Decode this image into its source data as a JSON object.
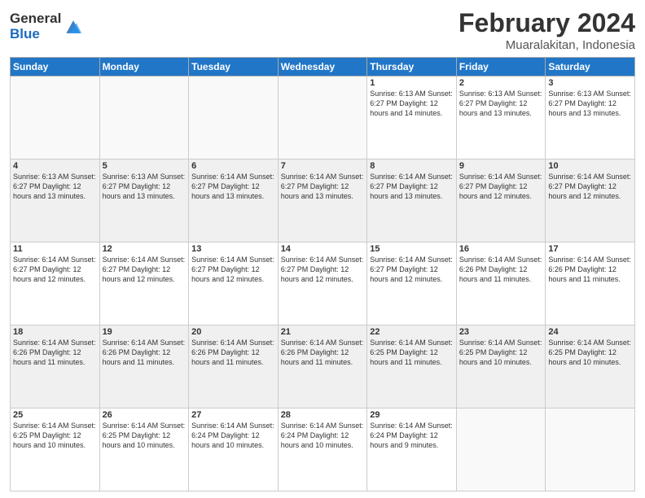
{
  "logo": {
    "general": "General",
    "blue": "Blue"
  },
  "title": {
    "month": "February 2024",
    "location": "Muaralakitan, Indonesia"
  },
  "days_header": [
    "Sunday",
    "Monday",
    "Tuesday",
    "Wednesday",
    "Thursday",
    "Friday",
    "Saturday"
  ],
  "weeks": [
    {
      "shaded": false,
      "days": [
        {
          "num": "",
          "info": ""
        },
        {
          "num": "",
          "info": ""
        },
        {
          "num": "",
          "info": ""
        },
        {
          "num": "",
          "info": ""
        },
        {
          "num": "1",
          "info": "Sunrise: 6:13 AM\nSunset: 6:27 PM\nDaylight: 12 hours\nand 14 minutes."
        },
        {
          "num": "2",
          "info": "Sunrise: 6:13 AM\nSunset: 6:27 PM\nDaylight: 12 hours\nand 13 minutes."
        },
        {
          "num": "3",
          "info": "Sunrise: 6:13 AM\nSunset: 6:27 PM\nDaylight: 12 hours\nand 13 minutes."
        }
      ]
    },
    {
      "shaded": true,
      "days": [
        {
          "num": "4",
          "info": "Sunrise: 6:13 AM\nSunset: 6:27 PM\nDaylight: 12 hours\nand 13 minutes."
        },
        {
          "num": "5",
          "info": "Sunrise: 6:13 AM\nSunset: 6:27 PM\nDaylight: 12 hours\nand 13 minutes."
        },
        {
          "num": "6",
          "info": "Sunrise: 6:14 AM\nSunset: 6:27 PM\nDaylight: 12 hours\nand 13 minutes."
        },
        {
          "num": "7",
          "info": "Sunrise: 6:14 AM\nSunset: 6:27 PM\nDaylight: 12 hours\nand 13 minutes."
        },
        {
          "num": "8",
          "info": "Sunrise: 6:14 AM\nSunset: 6:27 PM\nDaylight: 12 hours\nand 13 minutes."
        },
        {
          "num": "9",
          "info": "Sunrise: 6:14 AM\nSunset: 6:27 PM\nDaylight: 12 hours\nand 12 minutes."
        },
        {
          "num": "10",
          "info": "Sunrise: 6:14 AM\nSunset: 6:27 PM\nDaylight: 12 hours\nand 12 minutes."
        }
      ]
    },
    {
      "shaded": false,
      "days": [
        {
          "num": "11",
          "info": "Sunrise: 6:14 AM\nSunset: 6:27 PM\nDaylight: 12 hours\nand 12 minutes."
        },
        {
          "num": "12",
          "info": "Sunrise: 6:14 AM\nSunset: 6:27 PM\nDaylight: 12 hours\nand 12 minutes."
        },
        {
          "num": "13",
          "info": "Sunrise: 6:14 AM\nSunset: 6:27 PM\nDaylight: 12 hours\nand 12 minutes."
        },
        {
          "num": "14",
          "info": "Sunrise: 6:14 AM\nSunset: 6:27 PM\nDaylight: 12 hours\nand 12 minutes."
        },
        {
          "num": "15",
          "info": "Sunrise: 6:14 AM\nSunset: 6:27 PM\nDaylight: 12 hours\nand 12 minutes."
        },
        {
          "num": "16",
          "info": "Sunrise: 6:14 AM\nSunset: 6:26 PM\nDaylight: 12 hours\nand 11 minutes."
        },
        {
          "num": "17",
          "info": "Sunrise: 6:14 AM\nSunset: 6:26 PM\nDaylight: 12 hours\nand 11 minutes."
        }
      ]
    },
    {
      "shaded": true,
      "days": [
        {
          "num": "18",
          "info": "Sunrise: 6:14 AM\nSunset: 6:26 PM\nDaylight: 12 hours\nand 11 minutes."
        },
        {
          "num": "19",
          "info": "Sunrise: 6:14 AM\nSunset: 6:26 PM\nDaylight: 12 hours\nand 11 minutes."
        },
        {
          "num": "20",
          "info": "Sunrise: 6:14 AM\nSunset: 6:26 PM\nDaylight: 12 hours\nand 11 minutes."
        },
        {
          "num": "21",
          "info": "Sunrise: 6:14 AM\nSunset: 6:26 PM\nDaylight: 12 hours\nand 11 minutes."
        },
        {
          "num": "22",
          "info": "Sunrise: 6:14 AM\nSunset: 6:25 PM\nDaylight: 12 hours\nand 11 minutes."
        },
        {
          "num": "23",
          "info": "Sunrise: 6:14 AM\nSunset: 6:25 PM\nDaylight: 12 hours\nand 10 minutes."
        },
        {
          "num": "24",
          "info": "Sunrise: 6:14 AM\nSunset: 6:25 PM\nDaylight: 12 hours\nand 10 minutes."
        }
      ]
    },
    {
      "shaded": false,
      "days": [
        {
          "num": "25",
          "info": "Sunrise: 6:14 AM\nSunset: 6:25 PM\nDaylight: 12 hours\nand 10 minutes."
        },
        {
          "num": "26",
          "info": "Sunrise: 6:14 AM\nSunset: 6:25 PM\nDaylight: 12 hours\nand 10 minutes."
        },
        {
          "num": "27",
          "info": "Sunrise: 6:14 AM\nSunset: 6:24 PM\nDaylight: 12 hours\nand 10 minutes."
        },
        {
          "num": "28",
          "info": "Sunrise: 6:14 AM\nSunset: 6:24 PM\nDaylight: 12 hours\nand 10 minutes."
        },
        {
          "num": "29",
          "info": "Sunrise: 6:14 AM\nSunset: 6:24 PM\nDaylight: 12 hours\nand 9 minutes."
        },
        {
          "num": "",
          "info": ""
        },
        {
          "num": "",
          "info": ""
        }
      ]
    }
  ]
}
